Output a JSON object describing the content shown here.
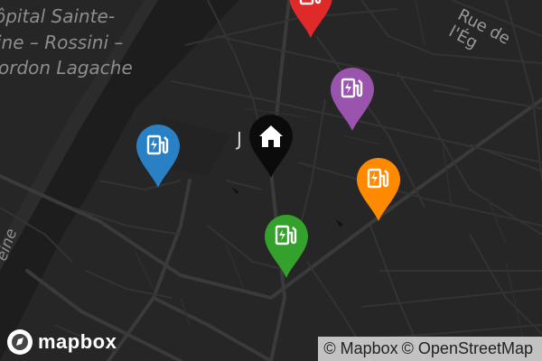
{
  "map": {
    "labels": {
      "area_line1": "ôpital Sainte-",
      "area_line2": "ine – Rossini –",
      "area_line3": "ordon Lagache",
      "street_right": "Rue de l'Ég",
      "poi": "J  EL",
      "river_left": "eine"
    },
    "markers": [
      {
        "color": "#e02a2a",
        "icon": "ev-charging-icon"
      },
      {
        "color": "#9a54ad",
        "icon": "ev-charging-icon"
      },
      {
        "color": "#2980c4",
        "icon": "ev-charging-icon"
      },
      {
        "color": "#0b0b0b",
        "icon": "home-icon"
      },
      {
        "color": "#ff8a00",
        "icon": "ev-charging-icon"
      },
      {
        "color": "#33a12b",
        "icon": "ev-charging-icon"
      }
    ]
  },
  "branding": {
    "logo_text": "mapbox"
  },
  "attribution": {
    "mapbox": "© Mapbox",
    "osm": "© OpenStreetMap"
  }
}
